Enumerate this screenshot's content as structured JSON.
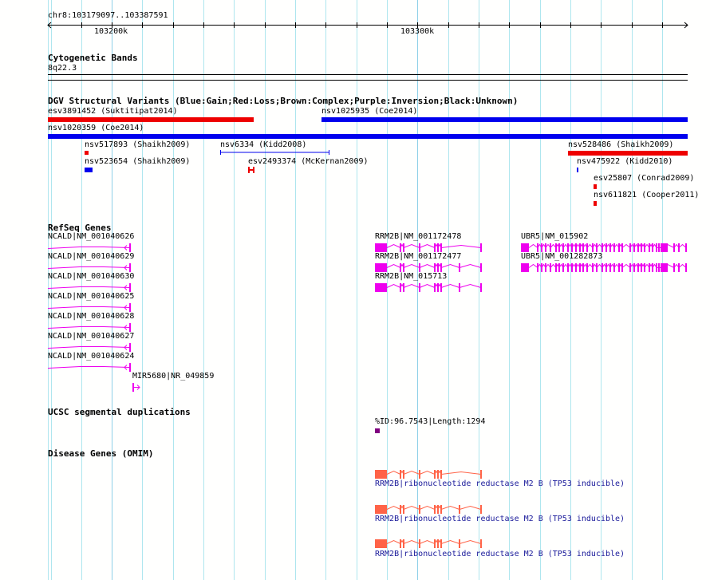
{
  "ruler": {
    "location": "chr8:103179097..103387591",
    "tick_labels": [
      "103200k",
      "103300k"
    ]
  },
  "tracks": {
    "cytoband": {
      "title": "Cytogenetic Bands",
      "band": "8q22.3"
    },
    "dgv": {
      "title": "DGV Structural Variants (Blue:Gain;Red:Loss;Brown:Complex;Purple:Inversion;Black:Unknown)",
      "colors": {
        "gain": "#0000ee",
        "loss": "#ee0000"
      },
      "features": [
        {
          "label": "esv3891452 (Suktitipat2014)",
          "type": "loss"
        },
        {
          "label": "nsv1025935 (Coe2014)",
          "type": "gain"
        },
        {
          "label": "nsv1020359 (Coe2014)",
          "type": "gain"
        },
        {
          "label": "nsv517893 (Shaikh2009)",
          "type": "loss"
        },
        {
          "label": "nsv6334 (Kidd2008)",
          "type": "gain"
        },
        {
          "label": "nsv523654 (Shaikh2009)",
          "type": "gain"
        },
        {
          "label": "esv2493374 (McKernan2009)",
          "type": "loss"
        },
        {
          "label": "nsv528486 (Shaikh2009)",
          "type": "loss"
        },
        {
          "label": "nsv475922 (Kidd2010)",
          "type": "gain"
        },
        {
          "label": "esv25807 (Conrad2009)",
          "type": "loss"
        },
        {
          "label": "nsv611821 (Cooper2011)",
          "type": "loss"
        }
      ]
    },
    "refseq": {
      "title": "RefSeq Genes",
      "color": "#ee00ee",
      "genes": [
        "NCALD|NM_001040626",
        "NCALD|NM_001040629",
        "NCALD|NM_001040630",
        "NCALD|NM_001040625",
        "NCALD|NM_001040628",
        "NCALD|NM_001040627",
        "NCALD|NM_001040624",
        "MIR5680|NR_049859",
        "RRM2B|NM_001172478",
        "RRM2B|NM_001172477",
        "RRM2B|NM_015713",
        "UBR5|NM_015902",
        "UBR5|NM_001282873"
      ]
    },
    "segdup": {
      "title": "UCSC segmental duplications",
      "feature": "%ID:96.7543|Length:1294",
      "color": "#800080"
    },
    "omim": {
      "title": "Disease Genes (OMIM)",
      "color": "#ff6347",
      "genes": [
        "RRM2B|ribonucleotide reductase M2 B (TP53 inducible)",
        "RRM2B|ribonucleotide reductase M2 B (TP53 inducible)",
        "RRM2B|ribonucleotide reductase M2 B (TP53 inducible)"
      ]
    }
  }
}
